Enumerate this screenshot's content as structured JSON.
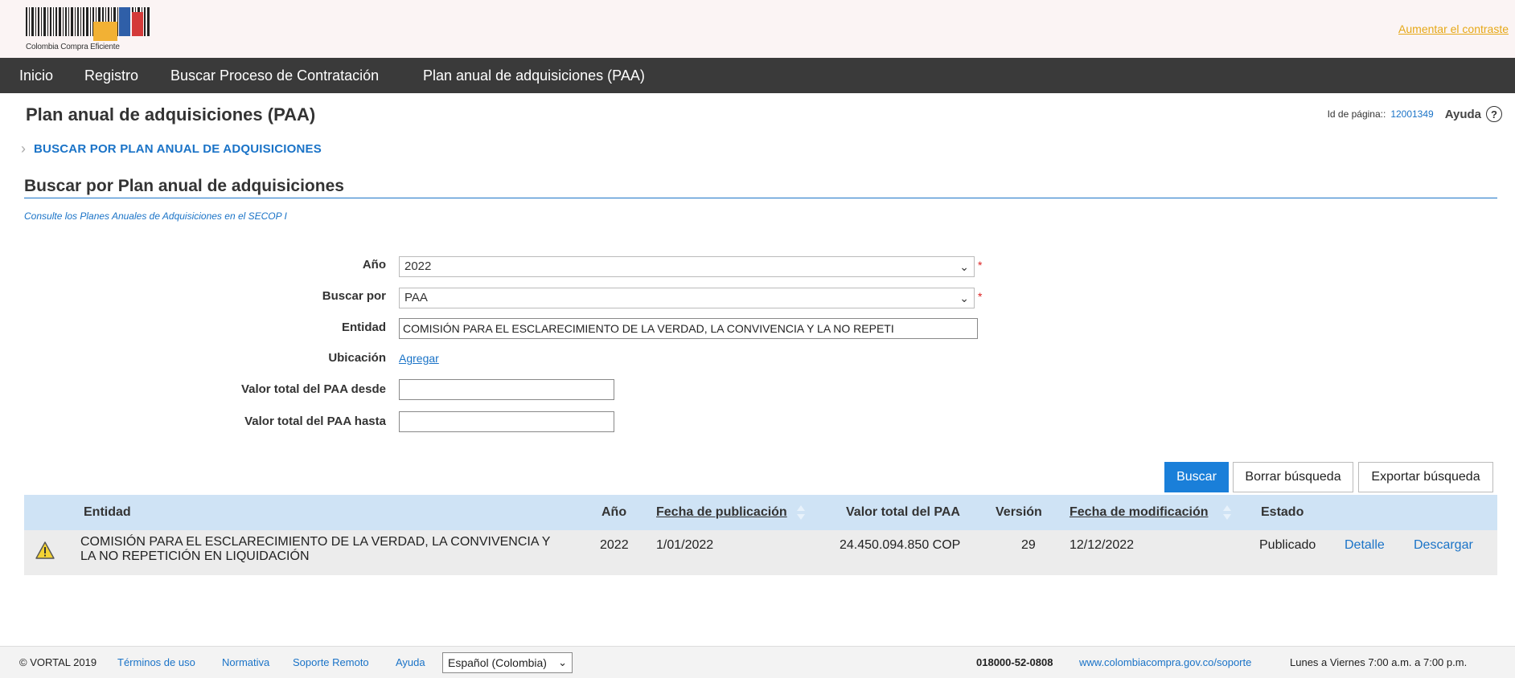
{
  "header": {
    "logo_text": "Colombia Compra Eficiente",
    "contrast_link": "Aumentar el contraste"
  },
  "nav": {
    "items": [
      {
        "label": "Inicio"
      },
      {
        "label": "Registro"
      },
      {
        "label": "Buscar Proceso de Contratación"
      },
      {
        "label": "Plan anual de adquisiciones (PAA)"
      }
    ]
  },
  "page": {
    "title": "Plan anual de adquisiciones (PAA)",
    "id_label": "Id de página::",
    "id_value": "12001349",
    "help_label": "Ayuda",
    "help_icon": "question-circle-icon",
    "breadcrumb": "BUSCAR POR PLAN ANUAL DE ADQUISICIONES"
  },
  "section": {
    "title": "Buscar por Plan anual de adquisiciones",
    "note": "Consulte los Planes Anuales de Adquisiciones en el SECOP I"
  },
  "form": {
    "anio_label": "Año",
    "anio_value": "2022",
    "buscar_por_label": "Buscar por",
    "buscar_por_value": "PAA",
    "entidad_label": "Entidad",
    "entidad_value": "COMISIÓN PARA EL ESCLARECIMIENTO DE LA VERDAD, LA CONVIVENCIA Y LA NO REPETI",
    "ubicacion_label": "Ubicación",
    "ubicacion_link": "Agregar",
    "desde_label": "Valor total del PAA desde",
    "desde_value": "",
    "hasta_label": "Valor total del PAA hasta",
    "hasta_value": "",
    "required_mark": "*"
  },
  "actions": {
    "buscar": "Buscar",
    "borrar": "Borrar búsqueda",
    "exportar": "Exportar búsqueda"
  },
  "table": {
    "headers": {
      "entidad": "Entidad",
      "anio": "Año",
      "fecha_publicacion": "Fecha de publicación",
      "valor_total": "Valor total del PAA",
      "version": "Versión",
      "fecha_modificacion": "Fecha de modificación",
      "estado": "Estado"
    },
    "rows": [
      {
        "entidad_line1": "COMISIÓN PARA EL ESCLARECIMIENTO DE LA VERDAD, LA CONVIVENCIA Y",
        "entidad_line2": "LA NO REPETICIÓN EN LIQUIDACIÓN",
        "anio": "2022",
        "fecha_publicacion": "1/01/2022",
        "valor_total": "24.450.094.850 COP",
        "version": "29",
        "fecha_modificacion": "12/12/2022",
        "estado": "Publicado",
        "detalle": "Detalle",
        "descargar": "Descargar",
        "icon": "warning-icon"
      }
    ]
  },
  "footer": {
    "copyright": "© VORTAL 2019",
    "terminos": "Términos de uso",
    "normativa": "Normativa",
    "soporte": "Soporte Remoto",
    "ayuda": "Ayuda",
    "idioma": "Español (Colombia)",
    "telefono": "018000-52-0808",
    "url": "www.colombiacompra.gov.co/soporte",
    "horario": "Lunes a Viernes 7:00 a.m. a 7:00 p.m."
  },
  "colors": {
    "accent": "#1a73c7",
    "navbar": "#3a3a3a",
    "table_header": "#cfe3f5",
    "contrast_link": "#e6a817"
  }
}
